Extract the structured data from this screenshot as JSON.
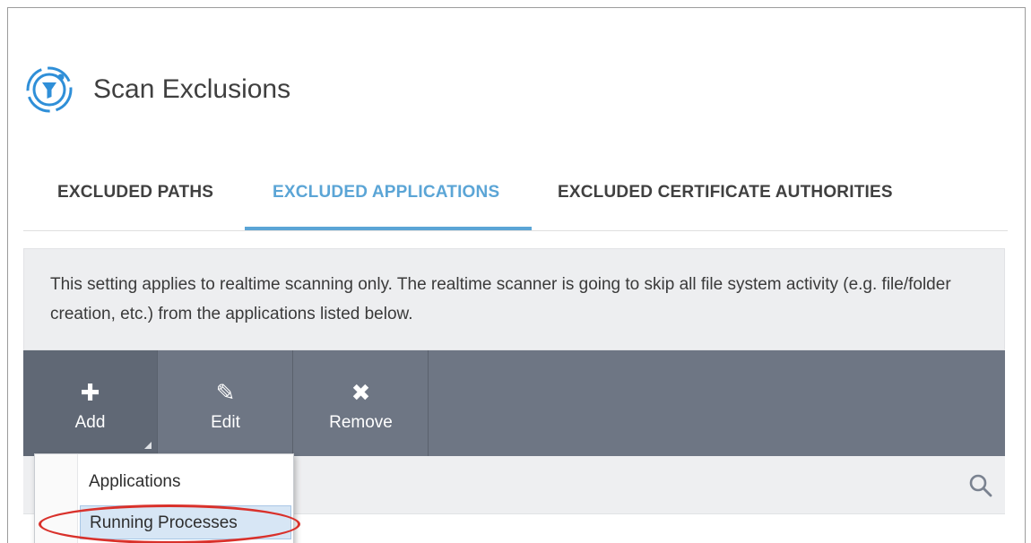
{
  "header": {
    "title": "Scan Exclusions",
    "icon": "filter-target-icon",
    "icon_color": "#2f8fd8"
  },
  "tabs": [
    {
      "label": "EXCLUDED PATHS",
      "active": false
    },
    {
      "label": "EXCLUDED APPLICATIONS",
      "active": true
    },
    {
      "label": "EXCLUDED CERTIFICATE AUTHORITIES",
      "active": false
    }
  ],
  "info": {
    "text": "This setting applies to realtime scanning only. The realtime scanner is going to skip all file system activity (e.g. file/folder creation, etc.) from the applications listed below."
  },
  "toolbar": {
    "add": {
      "label": "Add",
      "icon": "plus-icon"
    },
    "edit": {
      "label": "Edit",
      "icon": "pencil-icon"
    },
    "remove": {
      "label": "Remove",
      "icon": "x-icon"
    }
  },
  "dropdown": {
    "items": [
      {
        "label": "Applications"
      },
      {
        "label": "Running Processes",
        "highlighted": true
      }
    ]
  },
  "colors": {
    "accent": "#5ba5d6",
    "toolbar": "#6e7684",
    "highlight_ring": "#d9312b"
  }
}
